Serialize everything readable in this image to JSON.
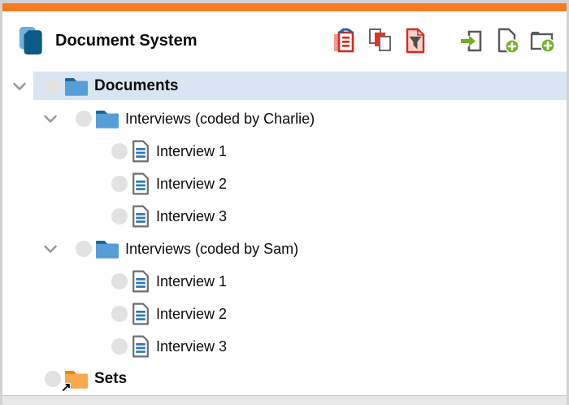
{
  "header": {
    "title": "Document System",
    "app_icon": "documents-stack-icon"
  },
  "toolbar": {
    "left_icons": [
      "reset-activations-icon",
      "activated-documents-icon",
      "filter-documents-icon"
    ],
    "right_icons": [
      "import-icon",
      "new-document-icon",
      "new-document-group-icon"
    ]
  },
  "tree": {
    "items": [
      {
        "label": "Documents",
        "level": 0,
        "icon": "folder-blue",
        "bold": true,
        "selected": true,
        "expanded": true
      },
      {
        "label": "Interviews (coded by Charlie)",
        "level": 1,
        "icon": "folder-blue",
        "bold": false,
        "selected": false,
        "expanded": true
      },
      {
        "label": "Interview 1",
        "level": 2,
        "icon": "document",
        "bold": false,
        "selected": false
      },
      {
        "label": "Interview 2",
        "level": 2,
        "icon": "document",
        "bold": false,
        "selected": false
      },
      {
        "label": "Interview 3",
        "level": 2,
        "icon": "document",
        "bold": false,
        "selected": false
      },
      {
        "label": "Interviews (coded by Sam)",
        "level": 1,
        "icon": "folder-blue",
        "bold": false,
        "selected": false,
        "expanded": true
      },
      {
        "label": "Interview 1",
        "level": 2,
        "icon": "document",
        "bold": false,
        "selected": false
      },
      {
        "label": "Interview 2",
        "level": 2,
        "icon": "document",
        "bold": false,
        "selected": false
      },
      {
        "label": "Interview 3",
        "level": 2,
        "icon": "document",
        "bold": false,
        "selected": false
      },
      {
        "label": "Sets",
        "level": 0,
        "icon": "folder-sets",
        "bold": true,
        "selected": false
      }
    ]
  },
  "colors": {
    "accent_orange": "#F87B20",
    "selection_blue": "#D8E5F2",
    "folder_blue": "#579ED9",
    "folder_blue_tab": "#19659C",
    "sets_orange": "#F9A950",
    "sets_orange_tab": "#EE8301",
    "toolbar_red": "#DA291C",
    "toolbar_green": "#73B32B",
    "document_line_blue": "#2E78B8"
  }
}
